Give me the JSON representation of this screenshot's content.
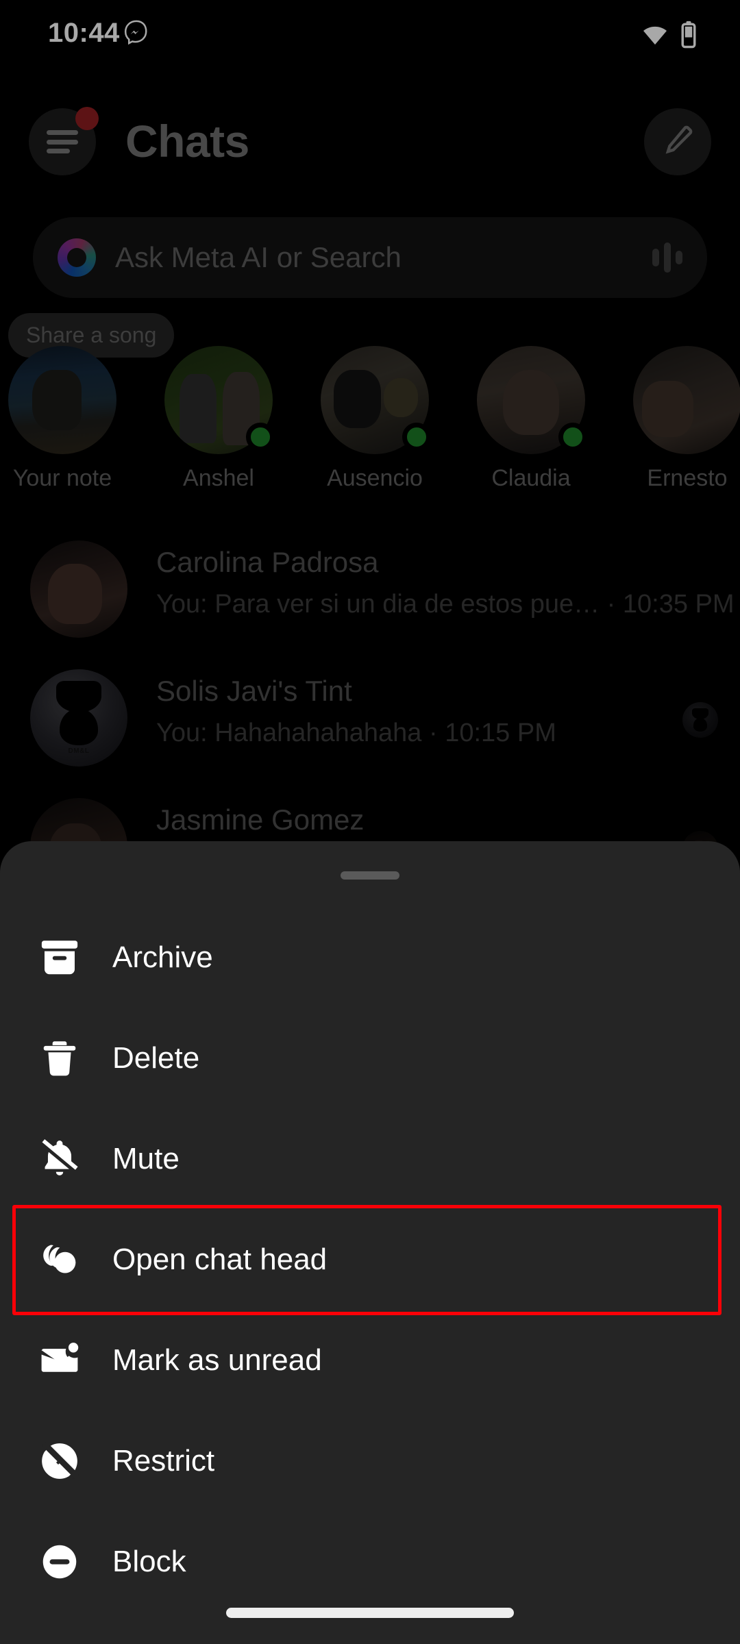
{
  "status_bar": {
    "time": "10:44",
    "messenger_icon": "messenger-icon",
    "wifi_icon": "wifi-icon",
    "battery_icon": "battery-icon"
  },
  "header": {
    "title": "Chats",
    "menu_icon": "hamburger-menu-icon",
    "menu_badge": "notification-badge",
    "compose_icon": "compose-pencil-icon"
  },
  "search": {
    "placeholder": "Ask Meta AI or Search",
    "meta_ai_icon": "meta-ai-ring-icon",
    "voice_icon": "voice-waveform-icon"
  },
  "notes": {
    "song_bubble": "Share a song",
    "items": [
      {
        "name": "Your note",
        "photo": "moto",
        "online": false
      },
      {
        "name": "Anshel",
        "photo": "couple",
        "online": true
      },
      {
        "name": "Ausencio",
        "photo": "mask",
        "online": true
      },
      {
        "name": "Claudia",
        "photo": "girl",
        "online": true
      },
      {
        "name": "Ernesto",
        "photo": "tattoo",
        "online": false
      }
    ]
  },
  "chats": [
    {
      "name": "Carolina Padrosa",
      "snippet": "You: Para ver si un dia de estos pue…  · 10:35 PM",
      "photo": "caro",
      "receipt": false
    },
    {
      "name": "Solis Javi's Tint",
      "snippet": "You: Hahahahahahaha · 10:15 PM",
      "photo": "dml",
      "receipt": true,
      "receipt_name": "read-receipt-avatar"
    },
    {
      "name": "Jasmine Gomez",
      "snippet": "",
      "photo": "jas",
      "receipt": true
    }
  ],
  "sheet": {
    "handle": "drag-handle",
    "highlight_color": "#fb0007",
    "background_color": "#252525",
    "items": [
      {
        "label": "Archive",
        "icon": "archive-box-icon",
        "highlighted": false
      },
      {
        "label": "Delete",
        "icon": "trash-icon",
        "highlighted": false
      },
      {
        "label": "Mute",
        "icon": "bell-slash-icon",
        "highlighted": false
      },
      {
        "label": "Open chat head",
        "icon": "chat-head-stack-icon",
        "highlighted": true
      },
      {
        "label": "Mark as unread",
        "icon": "envelope-dot-icon",
        "highlighted": false
      },
      {
        "label": "Restrict",
        "icon": "restrict-slash-icon",
        "highlighted": false
      },
      {
        "label": "Block",
        "icon": "block-minus-icon",
        "highlighted": false
      }
    ]
  },
  "nav_bar": {
    "home_pill": "gesture-home-pill"
  }
}
